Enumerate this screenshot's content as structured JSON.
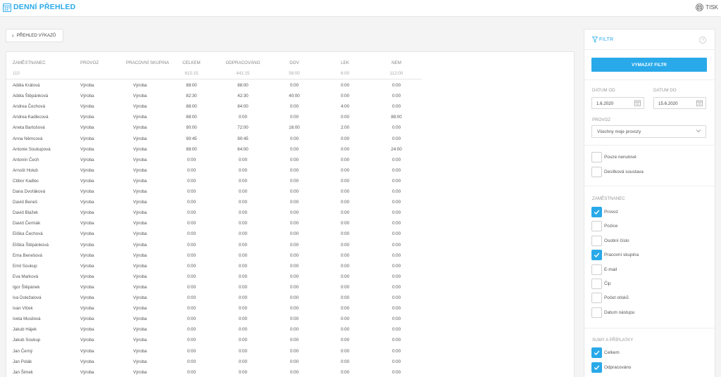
{
  "header": {
    "title": "DENNÍ PŘEHLED",
    "print_label": "TISK"
  },
  "toolbar": {
    "back_label": "PŘEHLED VÝKAZŮ"
  },
  "table": {
    "columns": [
      "ZAMĚSTNANEC",
      "PROVOZ",
      "PRACOVNÍ SKUPINA",
      "CELKEM",
      "ODPRACOVÁNO",
      "DOV",
      "LEK",
      "NEM"
    ],
    "summary": [
      "110",
      "",
      "",
      "615:15",
      "441:15",
      "56:00",
      "6:00",
      "112:00"
    ],
    "rows": [
      [
        "Adéla Králová",
        "Výroba",
        "Výroba",
        "88:00",
        "88:00",
        "0:00",
        "0:00",
        "0:00"
      ],
      [
        "Adéla Štěpánková",
        "Výroba",
        "Výroba",
        "82:30",
        "42:30",
        "40:00",
        "0:00",
        "0:00"
      ],
      [
        "Andrea Čechová",
        "Výroba",
        "Výroba",
        "88:00",
        "84:00",
        "0:00",
        "4:00",
        "0:00"
      ],
      [
        "Andrea Kadlecová",
        "Výroba",
        "Výroba",
        "88:00",
        "0:00",
        "0:00",
        "0:00",
        "88:00"
      ],
      [
        "Aneta Bartošová",
        "Výroba",
        "Výroba",
        "90:00",
        "72:00",
        "16:00",
        "2:00",
        "0:00"
      ],
      [
        "Anna Němcová",
        "Výroba",
        "Výroba",
        "90:45",
        "90:45",
        "0:00",
        "0:00",
        "0:00"
      ],
      [
        "Antonie Soukupová",
        "Výroba",
        "Výroba",
        "88:00",
        "64:00",
        "0:00",
        "0:00",
        "24:00"
      ],
      [
        "Antonín Čech",
        "Výroba",
        "Výroba",
        "0:00",
        "0:00",
        "0:00",
        "0:00",
        "0:00"
      ],
      [
        "Arnošt Holub",
        "Výroba",
        "Výroba",
        "0:00",
        "0:00",
        "0:00",
        "0:00",
        "0:00"
      ],
      [
        "Ctibor Kadlec",
        "Výroba",
        "Výroba",
        "0:00",
        "0:00",
        "0:00",
        "0:00",
        "0:00"
      ],
      [
        "Dana Dvořáková",
        "Výroba",
        "Výroba",
        "0:00",
        "0:00",
        "0:00",
        "0:00",
        "0:00"
      ],
      [
        "David Beneš",
        "Výroba",
        "Výroba",
        "0:00",
        "0:00",
        "0:00",
        "0:00",
        "0:00"
      ],
      [
        "David Blažek",
        "Výroba",
        "Výroba",
        "0:00",
        "0:00",
        "0:00",
        "0:00",
        "0:00"
      ],
      [
        "David Čermák",
        "Výroba",
        "Výroba",
        "0:00",
        "0:00",
        "0:00",
        "0:00",
        "0:00"
      ],
      [
        "Eliška Čechová",
        "Výroba",
        "Výroba",
        "0:00",
        "0:00",
        "0:00",
        "0:00",
        "0:00"
      ],
      [
        "Eliška Štěpánková",
        "Výroba",
        "Výroba",
        "0:00",
        "0:00",
        "0:00",
        "0:00",
        "0:00"
      ],
      [
        "Ema Benešová",
        "Výroba",
        "Výroba",
        "0:00",
        "0:00",
        "0:00",
        "0:00",
        "0:00"
      ],
      [
        "Emil Soukup",
        "Výroba",
        "Výroba",
        "0:00",
        "0:00",
        "0:00",
        "0:00",
        "0:00"
      ],
      [
        "Eva Marková",
        "Výroba",
        "Výroba",
        "0:00",
        "0:00",
        "0:00",
        "0:00",
        "0:00"
      ],
      [
        "Igor Štěpánek",
        "Výroba",
        "Výroba",
        "0:00",
        "0:00",
        "0:00",
        "0:00",
        "0:00"
      ],
      [
        "Iva Doležalová",
        "Výroba",
        "Výroba",
        "0:00",
        "0:00",
        "0:00",
        "0:00",
        "0:00"
      ],
      [
        "Ivan Vlček",
        "Výroba",
        "Výroba",
        "0:00",
        "0:00",
        "0:00",
        "0:00",
        "0:00"
      ],
      [
        "Iveta Musilová",
        "Výroba",
        "Výroba",
        "0:00",
        "0:00",
        "0:00",
        "0:00",
        "0:00"
      ],
      [
        "Jakub Hájek",
        "Výroba",
        "Výroba",
        "0:00",
        "0:00",
        "0:00",
        "0:00",
        "0:00"
      ],
      [
        "Jakub Soukup",
        "Výroba",
        "Výroba",
        "0:00",
        "0:00",
        "0:00",
        "0:00",
        "0:00"
      ],
      [
        "Jan Černý",
        "Výroba",
        "Výroba",
        "0:00",
        "0:00",
        "0:00",
        "0:00",
        "0:00"
      ],
      [
        "Jan Polák",
        "Výroba",
        "Výroba",
        "0:00",
        "0:00",
        "0:00",
        "0:00",
        "0:00"
      ],
      [
        "Jan Šimek",
        "Výroba",
        "Výroba",
        "0:00",
        "0:00",
        "0:00",
        "0:00",
        "0:00"
      ]
    ]
  },
  "filter": {
    "title": "FILTR",
    "clear_label": "VYMAZAT FILTR",
    "date_from_label": "DATUM OD",
    "date_to_label": "DATUM DO",
    "date_from": "1.6.2020",
    "date_to": "15.6.2020",
    "provoz_label": "PROVOZ",
    "provoz_value": "Všechny moje provozy",
    "options": [
      {
        "label": "Pouze nenulové",
        "checked": false
      },
      {
        "label": "Desítková soustava",
        "checked": false
      }
    ],
    "employee_section": "ZAMĚSTNANEC",
    "employee_fields": [
      {
        "label": "Provoz",
        "checked": true
      },
      {
        "label": "Pozice",
        "checked": false
      },
      {
        "label": "Osobní číslo",
        "checked": false
      },
      {
        "label": "Pracovní skupina",
        "checked": true
      },
      {
        "label": "E-mail",
        "checked": false
      },
      {
        "label": "Čip",
        "checked": false
      },
      {
        "label": "Počet otisků",
        "checked": false
      },
      {
        "label": "Datum nástupu",
        "checked": false
      }
    ],
    "sums_section": "SUMY A PŘÍPLATKY",
    "sums_fields": [
      {
        "label": "Celkem",
        "checked": true
      },
      {
        "label": "Odpracováno",
        "checked": true
      }
    ]
  },
  "colors": {
    "accent": "#29a9e9"
  }
}
